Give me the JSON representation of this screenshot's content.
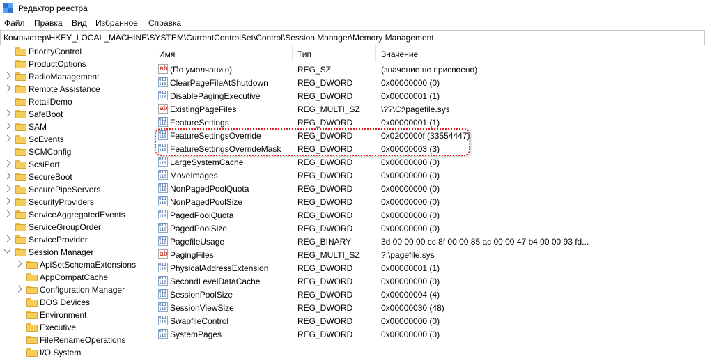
{
  "window": {
    "title": "Редактор реестра"
  },
  "menu": [
    {
      "label": "Файл"
    },
    {
      "label": "Правка"
    },
    {
      "label": "Вид"
    },
    {
      "label": "Избранное"
    },
    {
      "label": "Справка"
    }
  ],
  "address": "Компьютер\\HKEY_LOCAL_MACHINE\\SYSTEM\\CurrentControlSet\\Control\\Session Manager\\Memory Management",
  "tree": [
    {
      "label": "PriorityControl",
      "expander": "none",
      "level": 1
    },
    {
      "label": "ProductOptions",
      "expander": "none",
      "level": 1
    },
    {
      "label": "RadioManagement",
      "expander": "collapsed",
      "level": 1
    },
    {
      "label": "Remote Assistance",
      "expander": "collapsed",
      "level": 1
    },
    {
      "label": "RetailDemo",
      "expander": "none",
      "level": 1
    },
    {
      "label": "SafeBoot",
      "expander": "collapsed",
      "level": 1
    },
    {
      "label": "SAM",
      "expander": "collapsed",
      "level": 1
    },
    {
      "label": "ScEvents",
      "expander": "collapsed",
      "level": 1
    },
    {
      "label": "SCMConfig",
      "expander": "none",
      "level": 1
    },
    {
      "label": "ScsiPort",
      "expander": "collapsed",
      "level": 1
    },
    {
      "label": "SecureBoot",
      "expander": "collapsed",
      "level": 1
    },
    {
      "label": "SecurePipeServers",
      "expander": "collapsed",
      "level": 1
    },
    {
      "label": "SecurityProviders",
      "expander": "collapsed",
      "level": 1
    },
    {
      "label": "ServiceAggregatedEvents",
      "expander": "collapsed",
      "level": 1
    },
    {
      "label": "ServiceGroupOrder",
      "expander": "none",
      "level": 1
    },
    {
      "label": "ServiceProvider",
      "expander": "collapsed",
      "level": 1
    },
    {
      "label": "Session Manager",
      "expander": "expanded",
      "level": 1
    },
    {
      "label": "ApiSetSchemaExtensions",
      "expander": "collapsed",
      "level": 2
    },
    {
      "label": "AppCompatCache",
      "expander": "none",
      "level": 2
    },
    {
      "label": "Configuration Manager",
      "expander": "collapsed",
      "level": 2
    },
    {
      "label": "DOS Devices",
      "expander": "none",
      "level": 2
    },
    {
      "label": "Environment",
      "expander": "none",
      "level": 2
    },
    {
      "label": "Executive",
      "expander": "none",
      "level": 2
    },
    {
      "label": "FileRenameOperations",
      "expander": "none",
      "level": 2
    },
    {
      "label": "I/O System",
      "expander": "none",
      "level": 2
    }
  ],
  "list": {
    "columns": {
      "name": "Имя",
      "type": "Тип",
      "value": "Значение"
    },
    "rows": [
      {
        "icon": "string-value-icon",
        "name": "(По умолчанию)",
        "type": "REG_SZ",
        "value": "(значение не присвоено)"
      },
      {
        "icon": "binary-value-icon",
        "name": "ClearPageFileAtShutdown",
        "type": "REG_DWORD",
        "value": "0x00000000 (0)"
      },
      {
        "icon": "binary-value-icon",
        "name": "DisablePagingExecutive",
        "type": "REG_DWORD",
        "value": "0x00000001 (1)"
      },
      {
        "icon": "string-value-icon",
        "name": "ExistingPageFiles",
        "type": "REG_MULTI_SZ",
        "value": "\\??\\C:\\pagefile.sys"
      },
      {
        "icon": "binary-value-icon",
        "name": "FeatureSettings",
        "type": "REG_DWORD",
        "value": "0x00000001 (1)"
      },
      {
        "icon": "binary-value-icon",
        "name": "FeatureSettingsOverride",
        "type": "REG_DWORD",
        "value": "0x0200000f (33554447)"
      },
      {
        "icon": "binary-value-icon",
        "name": "FeatureSettingsOverrideMask",
        "type": "REG_DWORD",
        "value": "0x00000003 (3)"
      },
      {
        "icon": "binary-value-icon",
        "name": "LargeSystemCache",
        "type": "REG_DWORD",
        "value": "0x00000000 (0)"
      },
      {
        "icon": "binary-value-icon",
        "name": "MoveImages",
        "type": "REG_DWORD",
        "value": "0x00000000 (0)"
      },
      {
        "icon": "binary-value-icon",
        "name": "NonPagedPoolQuota",
        "type": "REG_DWORD",
        "value": "0x00000000 (0)"
      },
      {
        "icon": "binary-value-icon",
        "name": "NonPagedPoolSize",
        "type": "REG_DWORD",
        "value": "0x00000000 (0)"
      },
      {
        "icon": "binary-value-icon",
        "name": "PagedPoolQuota",
        "type": "REG_DWORD",
        "value": "0x00000000 (0)"
      },
      {
        "icon": "binary-value-icon",
        "name": "PagedPoolSize",
        "type": "REG_DWORD",
        "value": "0x00000000 (0)"
      },
      {
        "icon": "binary-value-icon",
        "name": "PagefileUsage",
        "type": "REG_BINARY",
        "value": "3d 00 00 00 cc 8f 00 00 85 ac 00 00 47 b4 00 00 93 fd..."
      },
      {
        "icon": "string-value-icon",
        "name": "PagingFiles",
        "type": "REG_MULTI_SZ",
        "value": "?:\\pagefile.sys"
      },
      {
        "icon": "binary-value-icon",
        "name": "PhysicalAddressExtension",
        "type": "REG_DWORD",
        "value": "0x00000001 (1)"
      },
      {
        "icon": "binary-value-icon",
        "name": "SecondLevelDataCache",
        "type": "REG_DWORD",
        "value": "0x00000000 (0)"
      },
      {
        "icon": "binary-value-icon",
        "name": "SessionPoolSize",
        "type": "REG_DWORD",
        "value": "0x00000004 (4)"
      },
      {
        "icon": "binary-value-icon",
        "name": "SessionViewSize",
        "type": "REG_DWORD",
        "value": "0x00000030 (48)"
      },
      {
        "icon": "binary-value-icon",
        "name": "SwapfileControl",
        "type": "REG_DWORD",
        "value": "0x00000000 (0)"
      },
      {
        "icon": "binary-value-icon",
        "name": "SystemPages",
        "type": "REG_DWORD",
        "value": "0x00000000 (0)"
      }
    ]
  },
  "annotation": {
    "highlighted_rows": [
      "FeatureSettingsOverride",
      "FeatureSettingsOverrideMask"
    ],
    "color": "#e02020"
  }
}
